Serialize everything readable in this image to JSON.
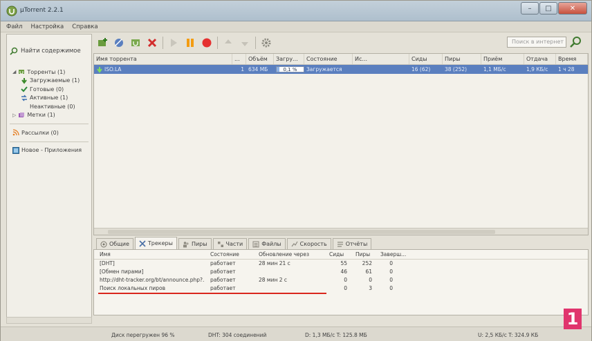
{
  "window": {
    "title": "µTorrent 2.2.1",
    "controls": [
      "–",
      "□",
      "✕"
    ]
  },
  "menu": {
    "items": [
      "Файл",
      "Настройка",
      "Справка"
    ]
  },
  "sidebar": {
    "search_label": "Найти содержимое",
    "tree": [
      {
        "label": "Торренты (1)",
        "icon": "torrents-icon"
      },
      {
        "label": "Загружаемые (1)",
        "icon": "download-arrow-icon"
      },
      {
        "label": "Готовые (0)",
        "icon": "check-icon"
      },
      {
        "label": "Активные (1)",
        "icon": "activity-icon"
      },
      {
        "label": "Неактивные (0)",
        "icon": "inactive-icon"
      },
      {
        "label": "Метки (1)",
        "icon": "labels-icon"
      }
    ],
    "feeds": "Рассылки (0)",
    "apps": "Новое - Приложения"
  },
  "toolbar": {
    "search_placeholder": "Поиск в интернет"
  },
  "torrent_table": {
    "columns": [
      "Имя торрента",
      "...",
      "Объём",
      "Загру...",
      "Состояние",
      "Ис...",
      "Сиды",
      "Пиры",
      "Приём",
      "Отдача",
      "Время"
    ],
    "rows": [
      {
        "name": "ISO.LA",
        "num": "1",
        "size": "634 МБ",
        "progress_text": "0,1 %",
        "progress": 0.1,
        "state": "Загружается",
        "source": "",
        "seeds": "16 (62)",
        "peers": "38 (252)",
        "down": "1,1 МБ/с",
        "up": "1,9 КБ/с",
        "eta": "1 ч 28"
      }
    ]
  },
  "tabs": [
    {
      "label": "Общие",
      "icon": "info-icon"
    },
    {
      "label": "Трекеры",
      "icon": "trackers-icon"
    },
    {
      "label": "Пиры",
      "icon": "peers-icon"
    },
    {
      "label": "Части",
      "icon": "pieces-icon"
    },
    {
      "label": "Файлы",
      "icon": "files-icon"
    },
    {
      "label": "Скорость",
      "icon": "speed-icon"
    },
    {
      "label": "Отчёты",
      "icon": "logger-icon"
    }
  ],
  "trackers": {
    "columns": [
      "Имя",
      "Состояние",
      "Обновление через",
      "Сиды",
      "Пиры",
      "Заверш..."
    ],
    "rows": [
      {
        "name": "[DHT]",
        "state": "работает",
        "update": "28 мин 21 с",
        "seeds": "55",
        "peers": "252",
        "done": "0"
      },
      {
        "name": "[Обмен пирами]",
        "state": "работает",
        "update": "",
        "seeds": "46",
        "peers": "61",
        "done": "0"
      },
      {
        "name": "http://dht-tracker.org/bt/announce.php?...",
        "state": "работает",
        "update": "28 мин 2 с",
        "seeds": "0",
        "peers": "0",
        "done": "0"
      },
      {
        "name": "Поиск локальных пиров",
        "state": "работает",
        "update": "",
        "seeds": "0",
        "peers": "3",
        "done": "0"
      }
    ]
  },
  "statusbar": {
    "disk": "Диск перегружен 96 %",
    "dht": "DHT: 304 соединений",
    "down": "D: 1,3 МБ/с T: 125.8 МБ",
    "up": "U: 2,5 КБ/с T: 324.9 КБ"
  },
  "badge": "1",
  "colors": {
    "selection": "#5a7fbf",
    "underline": "#d9261c",
    "badge": "#e0356d"
  }
}
